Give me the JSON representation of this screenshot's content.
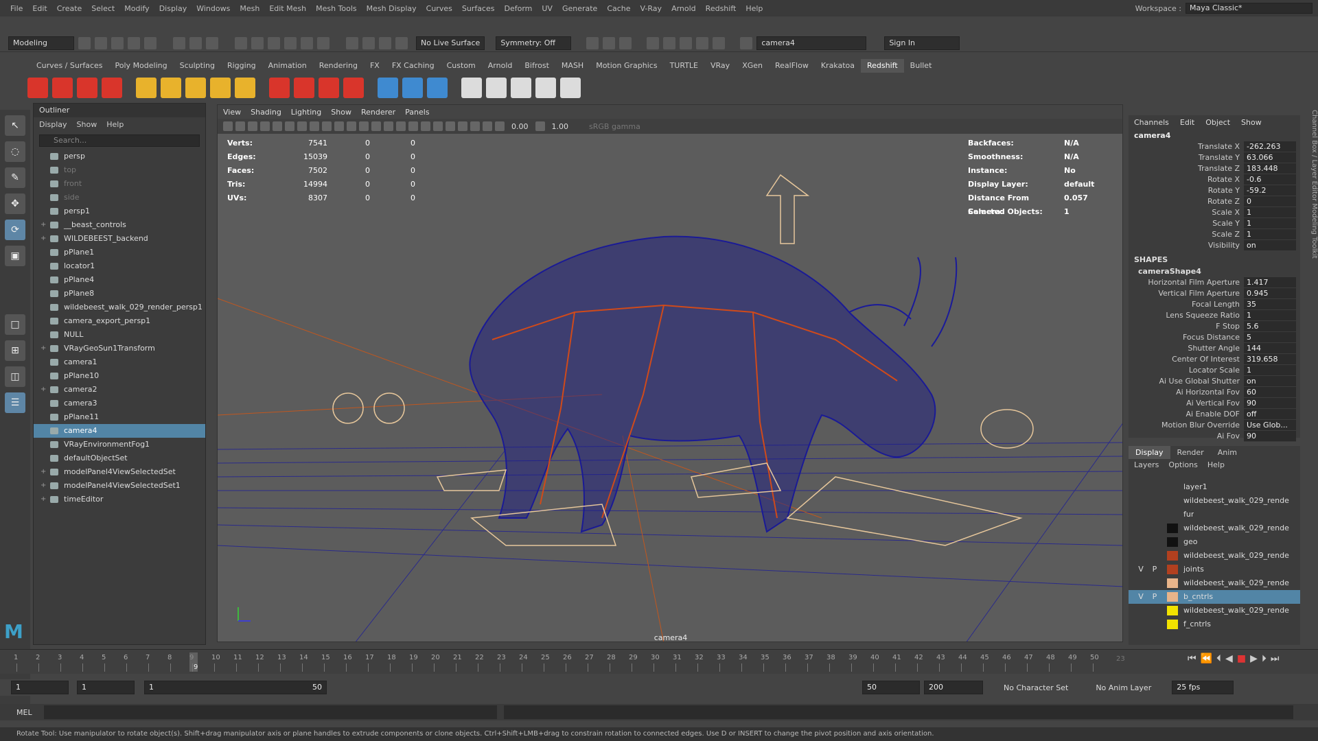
{
  "menubar": {
    "items": [
      "File",
      "Edit",
      "Create",
      "Select",
      "Modify",
      "Display",
      "Windows",
      "Mesh",
      "Edit Mesh",
      "Mesh Tools",
      "Mesh Display",
      "Curves",
      "Surfaces",
      "Deform",
      "UV",
      "Generate",
      "Cache",
      "V-Ray",
      "Arnold",
      "Redshift",
      "Help"
    ],
    "workspace_label": "Workspace :",
    "workspace_value": "Maya Classic*"
  },
  "statusline": {
    "mode": "Modeling",
    "live_surface": "No Live Surface",
    "symmetry": "Symmetry: Off",
    "camera_field": "camera4",
    "sign_in": "Sign In"
  },
  "shelf": {
    "tabs": [
      "Curves / Surfaces",
      "Poly Modeling",
      "Sculpting",
      "Rigging",
      "Animation",
      "Rendering",
      "FX",
      "FX Caching",
      "Custom",
      "Arnold",
      "Bifrost",
      "MASH",
      "Motion Graphics",
      "TURTLE",
      "VRay",
      "XGen",
      "RealFlow",
      "Krakatoa",
      "Redshift",
      "Bullet"
    ],
    "active_tab": "Redshift",
    "icon_colors": [
      "#d9352b",
      "#d9352b",
      "#d9352b",
      "#d9352b",
      "#e8b22c",
      "#e8b22c",
      "#e8b22c",
      "#e8b22c",
      "#e8b22c",
      "#d9352b",
      "#d9352b",
      "#d9352b",
      "#d9352b",
      "#3f8ad0",
      "#3f8ad0",
      "#3f8ad0",
      "#dcdcdc",
      "#dcdcdc",
      "#dcdcdc",
      "#dcdcdc",
      "#dcdcdc"
    ]
  },
  "outliner": {
    "title": "Outliner",
    "menu": [
      "Display",
      "Show",
      "Help"
    ],
    "search_placeholder": "Search...",
    "items": [
      {
        "label": "persp",
        "state": "normal",
        "expand": ""
      },
      {
        "label": "top",
        "state": "dim",
        "expand": ""
      },
      {
        "label": "front",
        "state": "dim",
        "expand": ""
      },
      {
        "label": "side",
        "state": "dim",
        "expand": ""
      },
      {
        "label": "persp1",
        "state": "normal",
        "expand": ""
      },
      {
        "label": "__beast_controls",
        "state": "normal",
        "expand": "+"
      },
      {
        "label": "WILDEBEEST_backend",
        "state": "normal",
        "expand": "+"
      },
      {
        "label": "pPlane1",
        "state": "normal",
        "expand": ""
      },
      {
        "label": "locator1",
        "state": "normal",
        "expand": ""
      },
      {
        "label": "pPlane4",
        "state": "normal",
        "expand": ""
      },
      {
        "label": "pPlane8",
        "state": "normal",
        "expand": ""
      },
      {
        "label": "wildebeest_walk_029_render_persp1",
        "state": "normal",
        "expand": ""
      },
      {
        "label": "camera_export_persp1",
        "state": "normal",
        "expand": ""
      },
      {
        "label": "NULL",
        "state": "normal",
        "expand": ""
      },
      {
        "label": "VRayGeoSun1Transform",
        "state": "normal",
        "expand": "+"
      },
      {
        "label": "camera1",
        "state": "normal",
        "expand": ""
      },
      {
        "label": "pPlane10",
        "state": "normal",
        "expand": ""
      },
      {
        "label": "camera2",
        "state": "normal",
        "expand": "+"
      },
      {
        "label": "camera3",
        "state": "normal",
        "expand": ""
      },
      {
        "label": "pPlane11",
        "state": "normal",
        "expand": ""
      },
      {
        "label": "camera4",
        "state": "selected",
        "expand": ""
      },
      {
        "label": "VRayEnvironmentFog1",
        "state": "normal",
        "expand": ""
      },
      {
        "label": "defaultObjectSet",
        "state": "normal",
        "expand": ""
      },
      {
        "label": "modelPanel4ViewSelectedSet",
        "state": "normal",
        "expand": "+"
      },
      {
        "label": "modelPanel4ViewSelectedSet1",
        "state": "normal",
        "expand": "+"
      },
      {
        "label": "timeEditor",
        "state": "normal",
        "expand": "+"
      }
    ]
  },
  "viewport": {
    "menu": [
      "View",
      "Shading",
      "Lighting",
      "Show",
      "Renderer",
      "Panels"
    ],
    "near_value": "0.00",
    "far_value": "1.00",
    "color_space": "sRGB gamma",
    "camera_label": "camera4",
    "hud_left": [
      {
        "k": "Verts:",
        "a": "7541",
        "b": "0",
        "c": "0"
      },
      {
        "k": "Edges:",
        "a": "15039",
        "b": "0",
        "c": "0"
      },
      {
        "k": "Faces:",
        "a": "7502",
        "b": "0",
        "c": "0"
      },
      {
        "k": "Tris:",
        "a": "14994",
        "b": "0",
        "c": "0"
      },
      {
        "k": "UVs:",
        "a": "8307",
        "b": "0",
        "c": "0"
      }
    ],
    "hud_right": [
      {
        "k": "Backfaces:",
        "v": "N/A"
      },
      {
        "k": "Smoothness:",
        "v": "N/A"
      },
      {
        "k": "Instance:",
        "v": "No"
      },
      {
        "k": "Display Layer:",
        "v": "default"
      },
      {
        "k": "Distance From Camera:",
        "v": "0.057"
      },
      {
        "k": "Selected Objects:",
        "v": "1"
      }
    ]
  },
  "channels": {
    "menu": [
      "Channels",
      "Edit",
      "Object",
      "Show"
    ],
    "object_name": "camera4",
    "attributes": [
      {
        "k": "Translate X",
        "v": "-262.263"
      },
      {
        "k": "Translate Y",
        "v": "63.066"
      },
      {
        "k": "Translate Z",
        "v": "183.448"
      },
      {
        "k": "Rotate X",
        "v": "-0.6"
      },
      {
        "k": "Rotate Y",
        "v": "-59.2"
      },
      {
        "k": "Rotate Z",
        "v": "0"
      },
      {
        "k": "Scale X",
        "v": "1"
      },
      {
        "k": "Scale Y",
        "v": "1"
      },
      {
        "k": "Scale Z",
        "v": "1"
      },
      {
        "k": "Visibility",
        "v": "on"
      }
    ],
    "shapes_label": "SHAPES",
    "shape_name": "cameraShape4",
    "shape_attributes": [
      {
        "k": "Horizontal Film Aperture",
        "v": "1.417"
      },
      {
        "k": "Vertical Film Aperture",
        "v": "0.945"
      },
      {
        "k": "Focal Length",
        "v": "35"
      },
      {
        "k": "Lens Squeeze Ratio",
        "v": "1"
      },
      {
        "k": "F Stop",
        "v": "5.6"
      },
      {
        "k": "Focus Distance",
        "v": "5"
      },
      {
        "k": "Shutter Angle",
        "v": "144"
      },
      {
        "k": "Center Of Interest",
        "v": "319.658"
      },
      {
        "k": "Locator Scale",
        "v": "1"
      },
      {
        "k": "Ai Use Global Shutter",
        "v": "on"
      },
      {
        "k": "Ai Horizontal Fov",
        "v": "60"
      },
      {
        "k": "Ai Vertical Fov",
        "v": "90"
      },
      {
        "k": "Ai Enable DOF",
        "v": "off"
      },
      {
        "k": "Motion Blur Override",
        "v": "Use Glob..."
      },
      {
        "k": "Ai Fov",
        "v": "90"
      }
    ],
    "side_tabs": "Channel Box / Layer Editor   Modeling Toolkit"
  },
  "layers": {
    "tabs": [
      "Display",
      "Render",
      "Anim"
    ],
    "menu": [
      "Layers",
      "Options",
      "Help"
    ],
    "rows": [
      {
        "name": "layer1",
        "color": "#3c3c3c",
        "v": "",
        "p": "",
        "sel": false
      },
      {
        "name": "wildebeest_walk_029_rende",
        "color": "#3c3c3c",
        "v": "",
        "p": "",
        "sel": false
      },
      {
        "name": "fur",
        "color": "#3c3c3c",
        "v": "",
        "p": "",
        "sel": false
      },
      {
        "name": "wildebeest_walk_029_rende",
        "color": "#111111",
        "v": "",
        "p": "",
        "sel": false
      },
      {
        "name": "geo",
        "color": "#111111",
        "v": "",
        "p": "",
        "sel": false
      },
      {
        "name": "wildebeest_walk_029_rende",
        "color": "#b2401f",
        "v": "",
        "p": "",
        "sel": false
      },
      {
        "name": "joints",
        "color": "#b2401f",
        "v": "V",
        "p": "P",
        "sel": false
      },
      {
        "name": "wildebeest_walk_029_rende",
        "color": "#e8b48a",
        "v": "",
        "p": "",
        "sel": false
      },
      {
        "name": "b_cntrls",
        "color": "#e8b48a",
        "v": "V",
        "p": "P",
        "sel": true
      },
      {
        "name": "wildebeest_walk_029_rende",
        "color": "#f2e200",
        "v": "",
        "p": "",
        "sel": false
      },
      {
        "name": "f_cntrls",
        "color": "#f2e200",
        "v": "",
        "p": "",
        "sel": false
      }
    ]
  },
  "timeline": {
    "ticks": [
      "1",
      "2",
      "3",
      "4",
      "5",
      "6",
      "7",
      "8",
      "9",
      "10",
      "11",
      "12",
      "13",
      "14",
      "15",
      "16",
      "17",
      "18",
      "19",
      "20",
      "21",
      "22",
      "23",
      "24",
      "25",
      "26",
      "27",
      "28",
      "29",
      "30",
      "31",
      "32",
      "33",
      "34",
      "35",
      "36",
      "37",
      "38",
      "39",
      "40",
      "41",
      "42",
      "43",
      "44",
      "45",
      "46",
      "47",
      "48",
      "49",
      "50"
    ],
    "current_frame": "9",
    "end_marker": "23",
    "playhead_frame": 9
  },
  "range": {
    "start": "1",
    "current": "1",
    "slider_start": "1",
    "slider_end": "50",
    "end": "50",
    "max": "200",
    "character_set": "No Character Set",
    "anim_layer": "No Anim Layer",
    "fps": "25 fps"
  },
  "cmdline": {
    "label": "MEL",
    "help": "Rotate Tool: Use manipulator to rotate object(s). Shift+drag manipulator axis or plane handles to extrude components or clone objects. Ctrl+Shift+LMB+drag to constrain rotation to connected edges. Use D or INSERT to change the pivot position and axis orientation."
  }
}
